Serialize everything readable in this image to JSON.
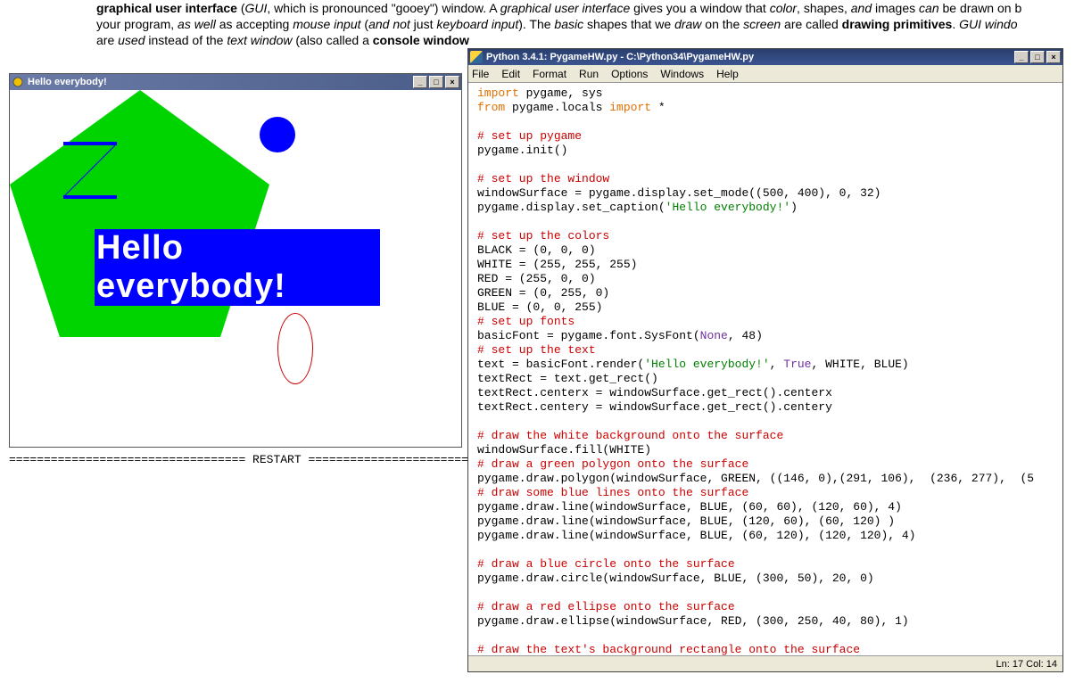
{
  "background_text": {
    "line1a": "graphical user interface",
    "line1b": " (",
    "line1c": "GUI",
    "line1d": ", which is pronounced \"gooey\") window. A ",
    "line1e": "graphical user interface",
    "line1f": " gives you a window that ",
    "line1g": "color",
    "line1h": ", shapes, ",
    "line1i": "and",
    "line1j": " images ",
    "line1k": "can",
    "line1l": " be drawn on b",
    "line2a": "your program, ",
    "line2b": "as well",
    "line2c": " as accepting ",
    "line2d": "mouse input",
    "line2e": " (",
    "line2f": "and not",
    "line2g": " just ",
    "line2h": "keyboard input",
    "line2i": "). The ",
    "line2j": "basic",
    "line2k": " shapes that we ",
    "line2l": "draw",
    "line2m": " on the ",
    "line2n": "screen",
    "line2o": " are called ",
    "line2p": "drawing primitives",
    "line2q": ". ",
    "line2r": "GUI windo",
    "line3a": "are ",
    "line3b": "used",
    "line3c": " instead of the ",
    "line3d": "text window",
    "line3e": " (also called a ",
    "line3f": "console window"
  },
  "restart_text": "================================== RESTART ==================================",
  "pygame_window": {
    "title": "Hello everybody!",
    "canvas_text": "Hello everybody!"
  },
  "idle_window": {
    "title": "Python 3.4.1: PygameHW.py - C:\\Python34\\PygameHW.py",
    "menu": {
      "file": "File",
      "edit": "Edit",
      "format": "Format",
      "run": "Run",
      "options": "Options",
      "windows": "Windows",
      "help": "Help"
    },
    "status": "Ln: 17 Col: 14"
  },
  "code": {
    "l1a": "import",
    "l1b": " pygame, sys",
    "l2a": "from",
    "l2b": " pygame.locals ",
    "l2c": "import",
    "l2d": " *",
    "l3": "",
    "l4": "# set up pygame",
    "l5": "pygame.init()",
    "l6": "",
    "l7": "# set up the window",
    "l8": "windowSurface = pygame.display.set_mode((500, 400), 0, 32)",
    "l9a": "pygame.display.set_caption(",
    "l9b": "'Hello everybody!'",
    "l9c": ")",
    "l10": "",
    "l11": "# set up the colors",
    "l12": "BLACK = (0, 0, 0)",
    "l13": "WHITE = (255, 255, 255)",
    "l14": "RED = (255, 0, 0)",
    "l15": "GREEN = (0, 255, 0)",
    "l16": "BLUE = (0, 0, 255)",
    "l17": "# set up fonts",
    "l18a": "basicFont = pygame.font.SysFont(",
    "l18b": "None",
    "l18c": ", 48)",
    "l19": "# set up the text",
    "l20a": "text = basicFont.render(",
    "l20b": "'Hello everybody!'",
    "l20c": ", ",
    "l20d": "True",
    "l20e": ", WHITE, BLUE)",
    "l21": "textRect = text.get_rect()",
    "l22": "textRect.centerx = windowSurface.get_rect().centerx",
    "l23": "textRect.centery = windowSurface.get_rect().centery",
    "l24": "",
    "l25": "# draw the white background onto the surface",
    "l26": "windowSurface.fill(WHITE)",
    "l27": "# draw a green polygon onto the surface",
    "l28": "pygame.draw.polygon(windowSurface, GREEN, ((146, 0),(291, 106),  (236, 277),  (5",
    "l29": "# draw some blue lines onto the surface",
    "l30": "pygame.draw.line(windowSurface, BLUE, (60, 60), (120, 60), 4)",
    "l31": "pygame.draw.line(windowSurface, BLUE, (120, 60), (60, 120) )",
    "l32": "pygame.draw.line(windowSurface, BLUE, (60, 120), (120, 120), 4)",
    "l33": "",
    "l34": "# draw a blue circle onto the surface",
    "l35": "pygame.draw.circle(windowSurface, BLUE, (300, 50), 20, 0)",
    "l36": "",
    "l37": "# draw a red ellipse onto the surface",
    "l38": "pygame.draw.ellipse(windowSurface, RED, (300, 250, 40, 80), 1)",
    "l39": "",
    "l40": "# draw the text's background rectangle onto the surface"
  }
}
